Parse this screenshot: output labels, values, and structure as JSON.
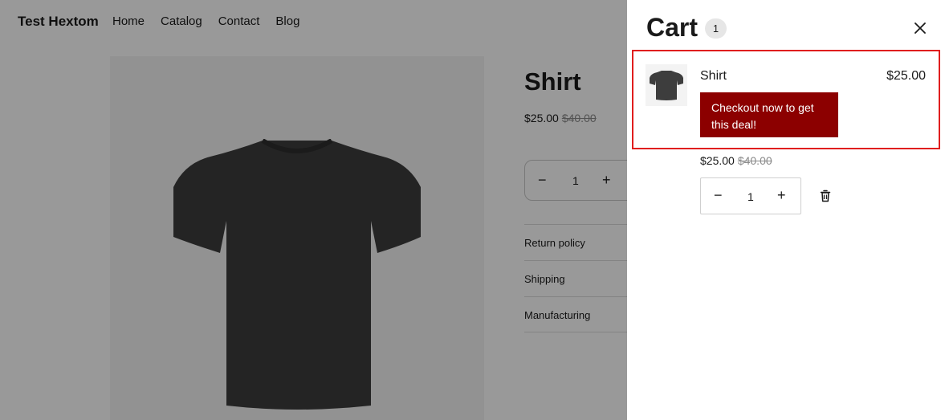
{
  "header": {
    "brand": "Test Hextom",
    "nav": [
      "Home",
      "Catalog",
      "Contact",
      "Blog"
    ]
  },
  "product": {
    "title": "Shirt",
    "price": "$25.00",
    "compare_price": "$40.00",
    "quantity": "1",
    "accordion": [
      "Return policy",
      "Shipping",
      "Manufacturing"
    ]
  },
  "cart": {
    "title": "Cart",
    "count": "1",
    "item": {
      "name": "Shirt",
      "line_price": "$25.00",
      "promo": "Checkout now to get this deal!",
      "price": "$25.00",
      "compare_price": "$40.00",
      "quantity": "1"
    }
  },
  "icons": {
    "minus": "−",
    "plus": "+",
    "close": "close-icon",
    "trash": "trash-icon"
  },
  "colors": {
    "promo_bg": "#8c0000",
    "highlight_border": "#e01e1e",
    "overlay": "rgba(0,0,0,0.4)"
  }
}
